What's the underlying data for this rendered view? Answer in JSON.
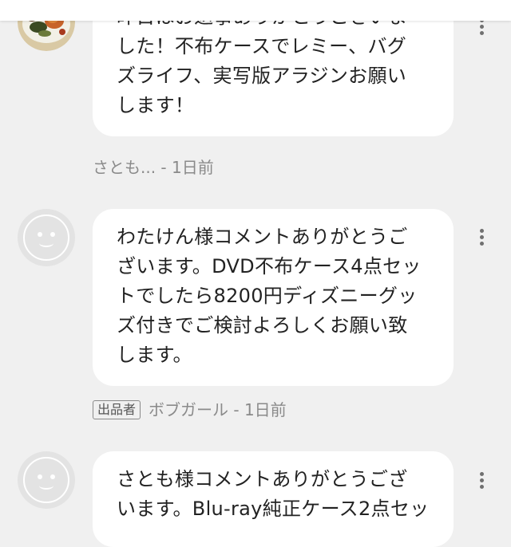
{
  "comments": [
    {
      "text": "昨日はお返事ありがとうございました！不布ケースでレミー、バグズライフ、実写版アラジンお願いします！",
      "display_lines": "昨日はお返事ありがとうございま\nした！不布ケースでレミー、バグ\nズライフ、実写版アラジンお願い\nします！",
      "author": "さとも...",
      "time": " - 1日前",
      "avatar": "food-photo-avatar",
      "is_seller": false
    },
    {
      "text": "わたけん様コメントありがとうございます。DVD不布ケース4点セットでしたら8200円ディズニーグッズ付きでご検討よろしくお願い致します。",
      "display_lines": "わたけん様コメントありがとうご\nざいます。DVD不布ケース4点セッ\nトでしたら8200円ディズニーグッ\nズ付きでご検討よろしくお願い致\nします。",
      "author": "ボブガール",
      "time": " - 1日前",
      "avatar": "default-face-avatar",
      "is_seller": true,
      "seller_label": "出品者"
    },
    {
      "display_lines": "さとも様コメントありがとうござ\nいます。Blu-ray純正ケース2点セッ",
      "avatar": "default-face-avatar",
      "is_seller": false
    }
  ],
  "icons": {
    "more": "more-vertical-icon"
  },
  "colors": {
    "background": "#f0f0f0",
    "bubble": "#ffffff",
    "meta_text": "#8a8a8a",
    "body_text": "#222222"
  }
}
